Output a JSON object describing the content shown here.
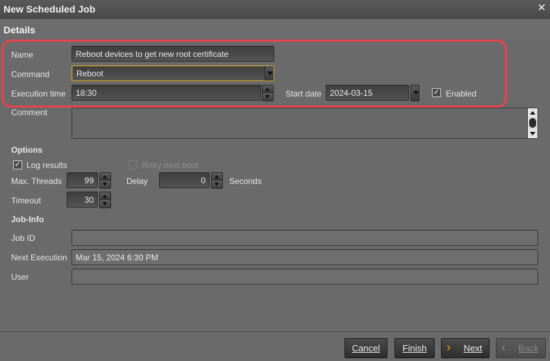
{
  "window": {
    "title": "New Scheduled Job"
  },
  "section": {
    "title": "Details"
  },
  "form": {
    "name_label": "Name",
    "name_value": "Reboot devices to get new root certificate",
    "command_label": "Command",
    "command_value": "Reboot",
    "execution_time_label": "Execution time",
    "execution_time_value": "18:30",
    "start_date_label": "Start date",
    "start_date_value": "2024-03-15",
    "enabled_label": "Enabled",
    "enabled_checked": true,
    "comment_label": "Comment",
    "comment_value": ""
  },
  "options": {
    "heading": "Options",
    "log_results_label": "Log results",
    "log_results_checked": true,
    "retry_next_boot_label": "Retry next boot",
    "retry_next_boot_checked": false,
    "max_threads_label": "Max. Threads",
    "max_threads_value": "99",
    "delay_label": "Delay",
    "delay_value": "0",
    "delay_unit": "Seconds",
    "timeout_label": "Timeout",
    "timeout_value": "30"
  },
  "jobinfo": {
    "heading": "Job-Info",
    "job_id_label": "Job ID",
    "job_id_value": "",
    "next_execution_label": "Next Execution",
    "next_execution_value": "Mar 15, 2024 6:30 PM",
    "user_label": "User",
    "user_value": ""
  },
  "footer": {
    "cancel_label": "Cancel",
    "finish_label": "Finish",
    "next_label": "Next",
    "back_label": "Back"
  },
  "icons": {
    "close": "close-icon",
    "next": "chevron-right-icon",
    "back": "chevron-left-icon"
  },
  "colors": {
    "highlight": "#e8434f",
    "accent": "#e0a800",
    "background": "#6a6a6a"
  }
}
